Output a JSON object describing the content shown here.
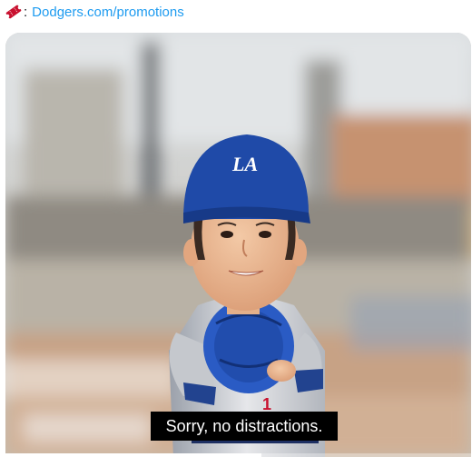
{
  "tweet": {
    "colon": ":",
    "link_text": "Dodgers.com/promotions",
    "icon": "ticket-icon"
  },
  "video": {
    "cap_logo": "LA",
    "caption": "Sorry, no distractions.",
    "progress": 0.55
  },
  "colors": {
    "link": "#1d9bf0",
    "dodger_blue": "#1f4aa8",
    "ticket_red": "#c8102e"
  }
}
